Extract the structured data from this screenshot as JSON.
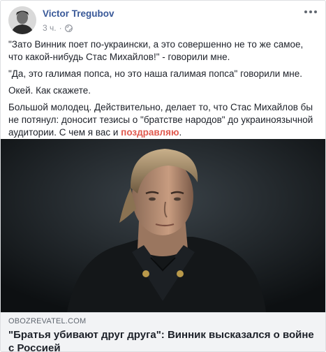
{
  "post": {
    "author": "Victor Tregubov",
    "time": "3 ч.",
    "separator": "·",
    "privacy_icon": "globe-icon",
    "menu_icon": "more-options-icon",
    "paragraphs": [
      "\"Зато Винник поет по-украински, а это совершенно не то же самое, что какой-нибудь Стас Михайлов!\" - говорили мне.",
      "\"Да, это галимая попса, но это наша галимая попса\" говорили мне.",
      "Окей. Как скажете."
    ],
    "last_paragraph_text": "Большой молодец. Действительно, делает то, что Стас Михайлов бы не потянул: доносит тезисы о \"братстве народов\" до украиноязычной аудитории. С чем я вас и ",
    "last_paragraph_link": "поздравляю",
    "last_paragraph_end": "."
  },
  "link_preview": {
    "domain": "OBOZREVATEL.COM",
    "title": "\"Братья убивают друг друга\": Винник высказался о войне с Россией"
  },
  "colors": {
    "author": "#385898",
    "highlight": "#e05a4f",
    "preview_bg": "#f2f3f5"
  }
}
